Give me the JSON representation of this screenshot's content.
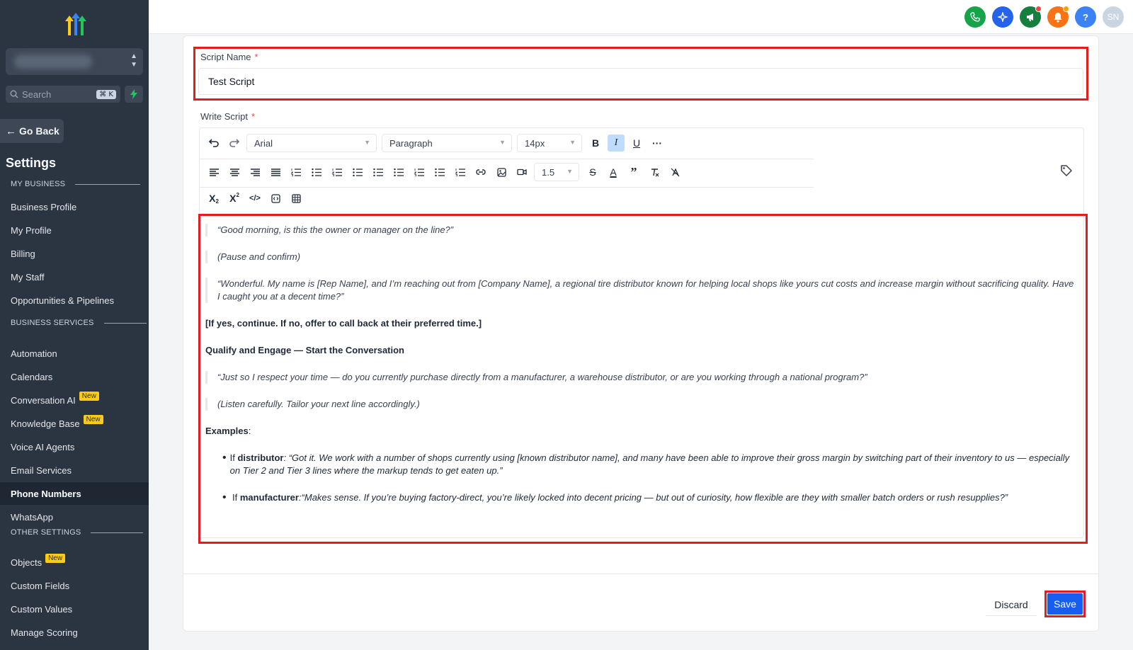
{
  "sidebar": {
    "search_placeholder": "Search",
    "search_shortcut": "⌘ K",
    "go_back": "Go Back",
    "title": "Settings",
    "sections": {
      "my_business": "MY BUSINESS",
      "business_services": "BUSINESS SERVICES",
      "other_settings": "OTHER SETTINGS"
    },
    "items": {
      "business_profile": "Business Profile",
      "my_profile": "My Profile",
      "billing": "Billing",
      "my_staff": "My Staff",
      "opportunities": "Opportunities & Pipelines",
      "automation": "Automation",
      "calendars": "Calendars",
      "conversation_ai": "Conversation AI",
      "knowledge_base": "Knowledge Base",
      "voice_ai": "Voice AI Agents",
      "email_services": "Email Services",
      "phone_numbers": "Phone Numbers",
      "whatsapp": "WhatsApp",
      "objects": "Objects",
      "custom_fields": "Custom Fields",
      "custom_values": "Custom Values",
      "manage_scoring": "Manage Scoring"
    },
    "new_badge": "New",
    "active_item": "Phone Numbers"
  },
  "topbar": {
    "icons": [
      "phone-icon",
      "sparkle-icon",
      "megaphone-icon",
      "bell-icon",
      "help-icon"
    ],
    "avatar_initials": "SN",
    "colors": {
      "phone": "#16a34a",
      "sparkle": "#2563eb",
      "megaphone": "#15803d",
      "bell": "#f97316",
      "help": "#3b82f6",
      "avatar": "#cbd5e1"
    }
  },
  "form": {
    "script_name_label": "Script Name",
    "script_name_value": "Test Script",
    "write_script_label": "Write Script",
    "required_mark": "*"
  },
  "toolbar": {
    "font": "Arial",
    "block": "Paragraph",
    "size": "14px",
    "line_height": "1.5"
  },
  "script": {
    "q1": "“Good morning, is this the owner or manager on the line?”",
    "q2": "(Pause and confirm)",
    "q3": "“Wonderful. My name is [Rep Name], and I’m reaching out from [Company Name], a regional tire distributor known for helping local shops like yours cut costs and increase margin without sacrificing quality. Have I caught you at a decent time?”",
    "instruction": "[If yes, continue. If no, offer to call back at their preferred time.]",
    "heading": "Qualify and Engage — Start the Conversation",
    "q4": "“Just so I respect your time — do you currently purchase directly from a manufacturer, a warehouse distributor, or are you working through a national program?”",
    "q5": "(Listen carefully. Tailor your next line accordingly.)",
    "examples_label": "Examples",
    "examples_colon": ":",
    "bullet1_prefix": "If ",
    "bullet1_bold": "distributor",
    "bullet1_text": ": “Got it. We work with a number of shops currently using [known distributor name], and many have been able to improve their gross margin by switching part of their inventory to us — especially on Tier 2 and Tier 3 lines where the markup tends to get eaten up.”",
    "bullet2_prefix": "If ",
    "bullet2_bold": "manufacturer",
    "bullet2_text": ":“Makes sense. If you’re buying factory-direct, you’re likely locked into decent pricing — but out of curiosity, how flexible are they with smaller batch orders or rush resupplies?”"
  },
  "actions": {
    "discard": "Discard",
    "save": "Save"
  },
  "colors": {
    "highlight": "#e11d20",
    "primary": "#155eef",
    "sidebar_bg": "#2b3441",
    "badge": "#facc15"
  }
}
